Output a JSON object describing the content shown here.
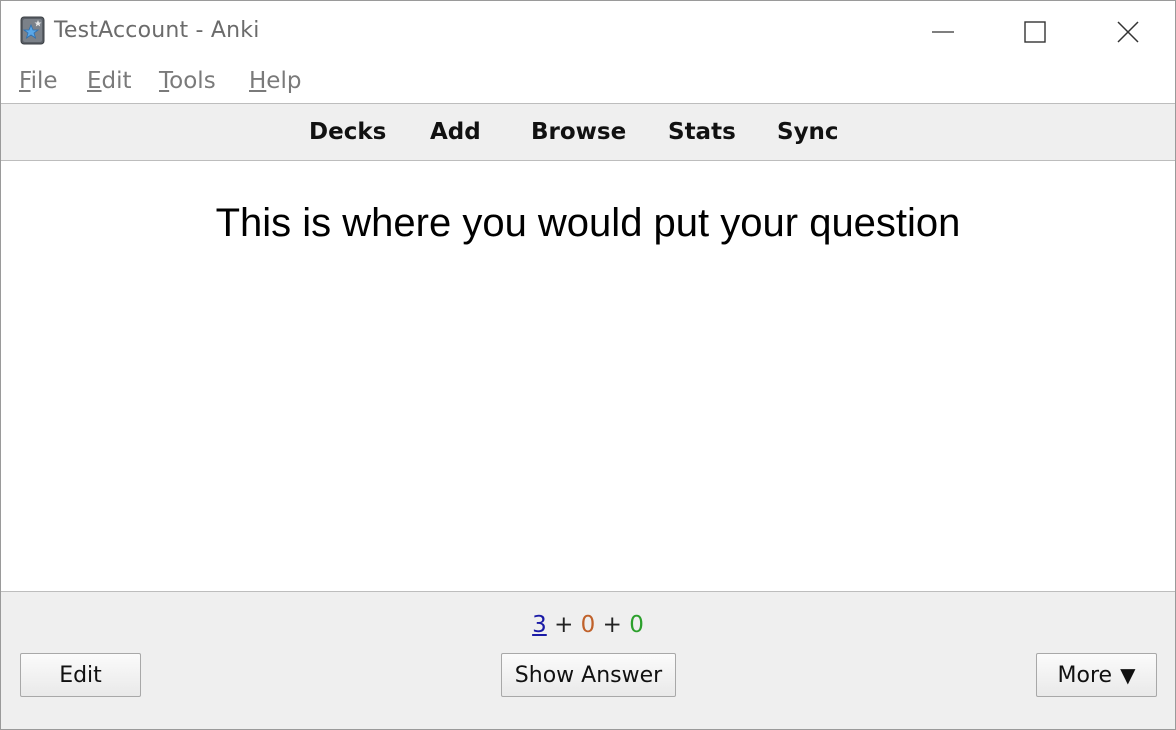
{
  "window": {
    "title": "TestAccount - Anki"
  },
  "menu": {
    "items": [
      {
        "prefix": "",
        "mnemonic": "F",
        "rest": "ile"
      },
      {
        "prefix": "",
        "mnemonic": "E",
        "rest": "dit"
      },
      {
        "prefix": "",
        "mnemonic": "T",
        "rest": "ools"
      },
      {
        "prefix": "",
        "mnemonic": "H",
        "rest": "elp"
      }
    ]
  },
  "toolbar": {
    "decks": "Decks",
    "add": "Add",
    "browse": "Browse",
    "stats": "Stats",
    "sync": "Sync"
  },
  "card": {
    "question": "This is where you would put your question"
  },
  "counts": {
    "new": "3",
    "sep1": "+",
    "learning": "0",
    "sep2": "+",
    "review": "0"
  },
  "buttons": {
    "edit": "Edit",
    "show_answer": "Show Answer",
    "more": "More",
    "more_arrow": "▼"
  },
  "colors": {
    "new_count": "#1a1aa6",
    "learning_count": "#c0612a",
    "review_count": "#2ca02c",
    "toolbar_bg": "#efefef"
  },
  "icons": [
    "anki-app-icon",
    "minimize-icon",
    "maximize-icon",
    "close-icon",
    "dropdown-arrow-icon"
  ]
}
